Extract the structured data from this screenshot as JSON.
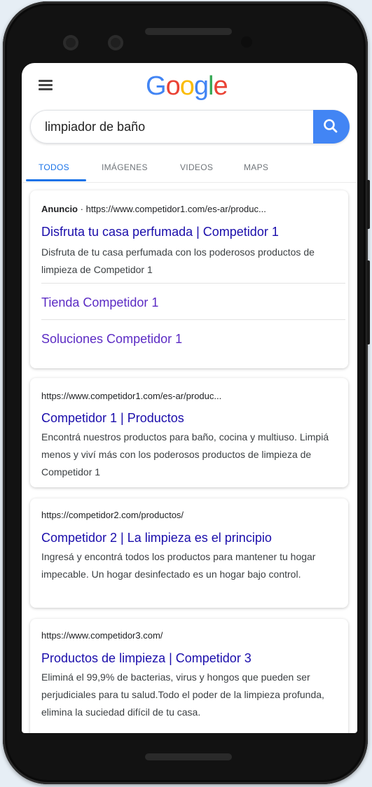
{
  "logo": {
    "letters": [
      "G",
      "o",
      "o",
      "g",
      "l",
      "e"
    ],
    "colors": [
      "#4285f4",
      "#ea4335",
      "#fbbc05",
      "#4285f4",
      "#34a853",
      "#ea4335"
    ]
  },
  "search": {
    "query": "limpiador de baño"
  },
  "tabs": [
    {
      "label": "TODOS",
      "active": true
    },
    {
      "label": "IMÁGENES"
    },
    {
      "label": "VIDEOS"
    },
    {
      "label": "MAPS"
    }
  ],
  "ad": {
    "badge": "Anuncio",
    "separator": "·",
    "url": "https://www.competidor1.com/es-ar/produc...",
    "title": "Disfruta tu casa perfumada | Competidor 1",
    "snippet": "Disfruta de tu casa perfumada con los poderosos productos de limpieza de Competidor 1",
    "sitelinks": [
      "Tienda Competidor 1",
      "Soluciones Competidor 1"
    ]
  },
  "results": [
    {
      "url": "https://www.competidor1.com/es-ar/produc...",
      "title": "Competidor 1 | Productos",
      "snippet": "Encontrá nuestros productos para baño, cocina y multiuso. Limpiá menos y viví más con los poderosos productos de limpieza de Competidor 1"
    },
    {
      "url": "https://competidor2.com/productos/",
      "title": "Competidor 2 | La limpieza es el principio",
      "snippet": "Ingresá y encontrá todos los productos para mantener tu hogar impecable. Un hogar desinfectado es un hogar bajo control."
    },
    {
      "url": "https://www.competidor3.com/",
      "title": "Productos de limpieza | Competidor 3",
      "snippet": "Eliminá el 99,9% de bacterias, virus y hongos que pueden ser perjudiciales para tu salud.Todo el poder de la limpieza profunda, elimina la suciedad difícil de tu casa."
    }
  ]
}
